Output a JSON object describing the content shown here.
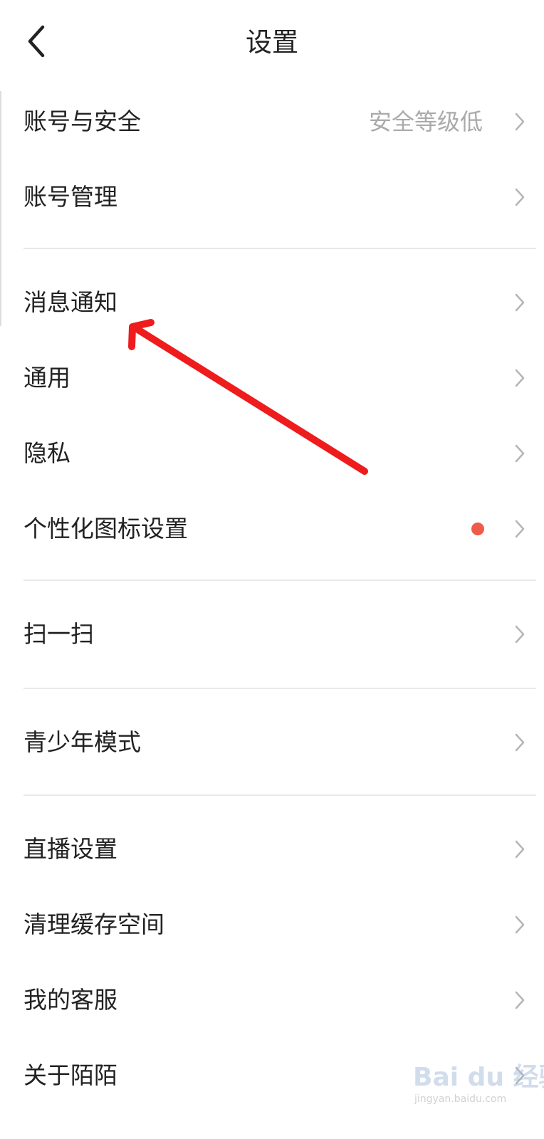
{
  "header": {
    "title": "设置"
  },
  "colors": {
    "badge_dot": "#ef5b4b",
    "annotation_arrow": "#ee1c1c",
    "secondary_text": "#aaaaaa"
  },
  "groups": [
    {
      "items": [
        {
          "label": "账号与安全",
          "value": "安全等级低"
        },
        {
          "label": "账号管理"
        }
      ]
    },
    {
      "items": [
        {
          "label": "消息通知"
        },
        {
          "label": "通用"
        },
        {
          "label": "隐私"
        },
        {
          "label": "个性化图标设置",
          "badge": "red-dot"
        }
      ]
    },
    {
      "items": [
        {
          "label": "扫一扫"
        }
      ]
    },
    {
      "items": [
        {
          "label": "青少年模式"
        }
      ]
    },
    {
      "items": [
        {
          "label": "直播设置"
        },
        {
          "label": "清理缓存空间"
        },
        {
          "label": "我的客服"
        },
        {
          "label": "关于陌陌"
        }
      ]
    }
  ],
  "watermark": {
    "logo": "Bai du 经验",
    "site": "jingyan.baidu.com"
  },
  "icons": {
    "back": "chevron-left-icon",
    "row_arrow": "chevron-right-icon",
    "annotation": "arrow-annotation-icon"
  }
}
